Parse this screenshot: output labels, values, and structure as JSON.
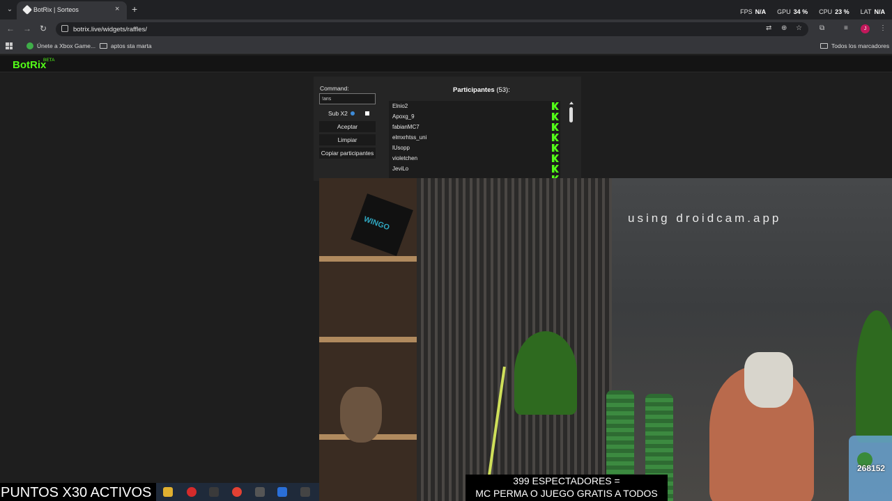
{
  "browser": {
    "tab_title": "BotRix | Sorteos",
    "tab_close": "×",
    "new_tab": "+",
    "url": "botrix.live/widgets/raffles/",
    "perf": {
      "fps_label": "FPS",
      "fps_value": "N/A",
      "gpu_label": "GPU",
      "gpu_value": "34 %",
      "cpu_label": "CPU",
      "cpu_value": "23 %",
      "lat_label": "LAT",
      "lat_value": "N/A"
    },
    "profile_initial": "J",
    "bookmarks": [
      {
        "label": "Únete a Xbox Game...",
        "icon": "xbox-icon"
      },
      {
        "label": "aptos sta marta",
        "icon": "folder-icon"
      }
    ],
    "all_bookmarks": "Todos los marcadores"
  },
  "botrix": {
    "logo": "BotRix",
    "beta": "BETA",
    "command_label": "Command:",
    "command_value": "!aris",
    "sub_label": "Sub X2",
    "buttons": {
      "accept": "Aceptar",
      "clear": "Limpiar",
      "copy": "Copiar participantes"
    },
    "participants_title": "Participantes",
    "participants_count": "(53):",
    "participants": [
      "Elnio2",
      "Apoxg_9",
      "fabianMC7",
      "elmxrhtss_uni",
      "lUsopp",
      "violetchen",
      "JeviLo"
    ]
  },
  "cam": {
    "watermark": "using droidcam.app",
    "box_label": "WINGO",
    "counter": "268152"
  },
  "overlay": {
    "points": "PUNTOS X30 ACTIVOS",
    "subtitle_line1": "399 ESPECTADORES =",
    "subtitle_line2": "MC PERMA O JUEGO GRATIS A TODOS"
  },
  "colors": {
    "brand_green": "#53fc18",
    "chrome_dark": "#202124",
    "chrome_mid": "#35363a"
  }
}
